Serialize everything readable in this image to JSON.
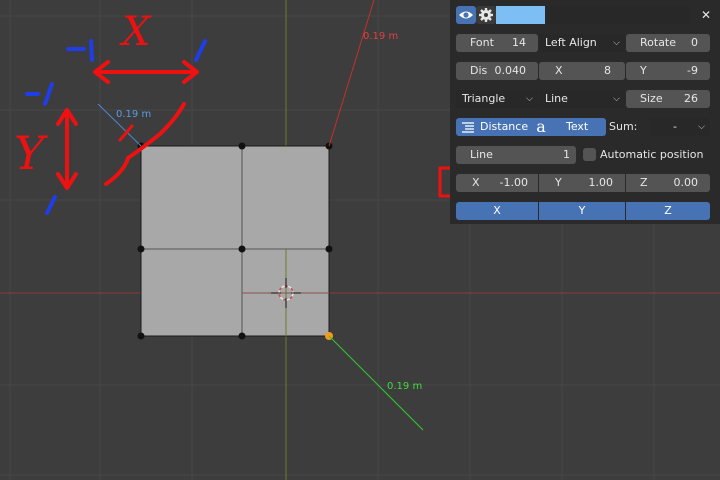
{
  "viewport": {
    "measurements": {
      "red_axis": "0.19 m",
      "blue_axis": "0.19 m",
      "green_axis": "0.19 m"
    },
    "annotations": {
      "x_letter": "X",
      "y_letter": "Y",
      "minus_one_top": "-1",
      "minus_one_left": "-1",
      "one_top": "/",
      "one_bottom": "/"
    }
  },
  "panel": {
    "header": {
      "eye_icon": "eye-icon",
      "gear_icon": "gear-icon",
      "name_value": "",
      "close_label": "✕"
    },
    "font": {
      "label": "Font",
      "value": "14"
    },
    "align": {
      "selected": "Left Align"
    },
    "rotate": {
      "label": "Rotate",
      "value": "0"
    },
    "dis": {
      "label": "Dis",
      "value": "0.040"
    },
    "offset_x": {
      "label": "X",
      "value": "8"
    },
    "offset_y": {
      "label": "Y",
      "value": "-9"
    },
    "arrow_type": {
      "selected": "Triangle"
    },
    "line_type": {
      "selected": "Line"
    },
    "size": {
      "label": "Size",
      "value": "26"
    },
    "mode_distance": {
      "label": "Distance"
    },
    "mode_text": {
      "label": "Text"
    },
    "sum": {
      "label": "Sum:",
      "selected": "-"
    },
    "line": {
      "label": "Line",
      "value": "1"
    },
    "auto_position": {
      "label": "Automatic position",
      "checked": false
    },
    "position": {
      "x_label": "X",
      "x_value": "-1.00",
      "y_label": "Y",
      "y_value": "1.00",
      "z_label": "Z",
      "z_value": "0.00"
    },
    "axis_buttons": {
      "x": "X",
      "y": "Y",
      "z": "Z"
    }
  }
}
